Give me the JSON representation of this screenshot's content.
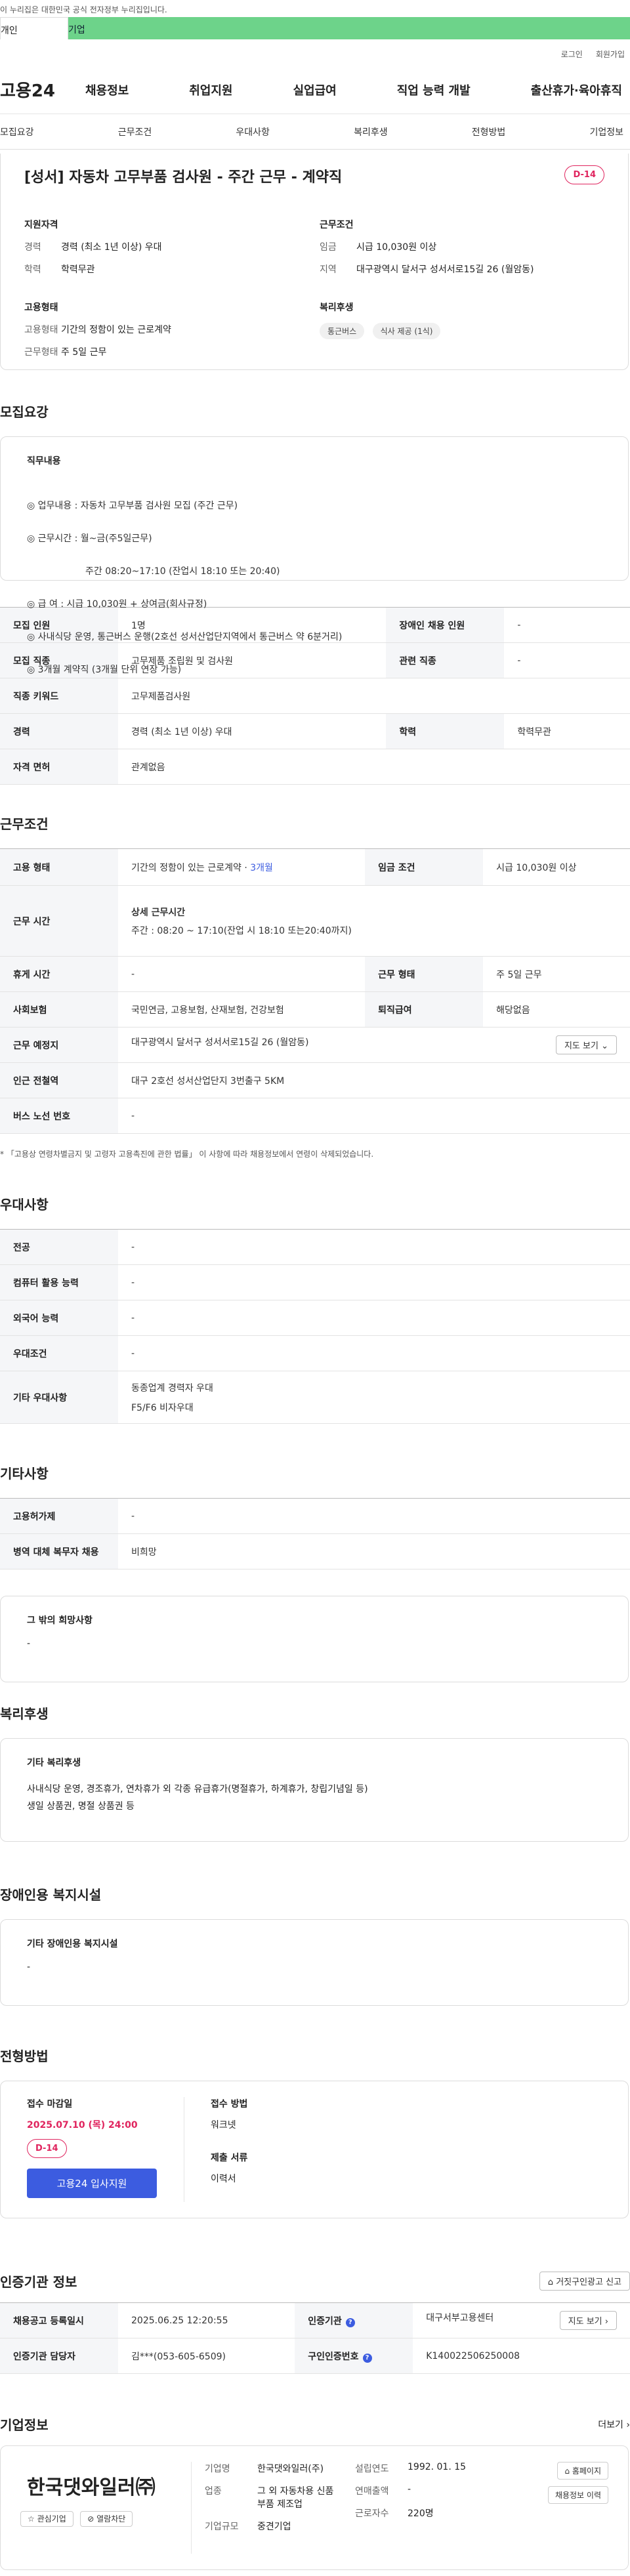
{
  "topbar": {
    "notice": "이 누리집은 대한민국 공식 전자정부 누리집입니다."
  },
  "site_tabs": [
    "개인",
    "기업"
  ],
  "util": [
    "로그인",
    "회원가입"
  ],
  "gnb": {
    "logo": "고용24",
    "menu": [
      "채용정보",
      "취업지원",
      "실업급여",
      "직업 능력 개발",
      "출산휴가·육아휴직"
    ]
  },
  "anchors": [
    "모집요강",
    "근무조건",
    "우대사항",
    "복리후생",
    "전형방법",
    "기업정보"
  ],
  "hero": {
    "title": "[성서] 자동차 고무부품 검사원 - 주간 근무 - 계약직",
    "dday": "D-14",
    "qual_title": "지원자격",
    "qual": [
      {
        "k": "경력",
        "v": "경력 (최소 1년 이상) 우대"
      },
      {
        "k": "학력",
        "v": "학력무관"
      }
    ],
    "emp_title": "고용형태",
    "emp": [
      {
        "k": "고용형태",
        "v": "기간의 정함이 있는 근로계약"
      },
      {
        "k": "근무형태",
        "v": "주 5일 근무"
      }
    ],
    "cond_title": "근무조건",
    "cond": [
      {
        "k": "임금",
        "v": "시급 10,030원 이상"
      },
      {
        "k": "지역",
        "v": "대구광역시 달서구 성서서로15길 26 (월암동)"
      }
    ],
    "welfare_title": "복리후생",
    "welfare_chips": [
      "통근버스",
      "식사 제공 (1식)"
    ]
  },
  "recruit": {
    "title": "모집요강",
    "box_title": "직무내용",
    "lines": [
      "◎ 업무내용 : 자동차 고무부품 검사원 모집 (주간 근무)",
      "◎ 근무시간 : 월~금(주5일근무)",
      "                    주간 08:20~17:10 (잔업시 18:10 또는 20:40)",
      "◎ 급 여 : 시급 10,030원 + 상여금(회사규정)",
      "◎ 사내식당 운영, 통근버스 운행(2호선 성서산업단지역에서 통근버스 약 6분거리)",
      "◎ 3개월 계약직 (3개월 단위 연장 가능)"
    ],
    "table": [
      [
        "모집 인원",
        "1명",
        "장애인 채용 인원",
        "-"
      ],
      [
        "모집 직종",
        "고무제품 조립원 및 검사원",
        "관련 직종",
        "-"
      ],
      [
        "직종 키워드",
        "고무제품검사원"
      ],
      [
        "경력",
        "경력 (최소 1년 이상) 우대",
        "학력",
        "학력무관"
      ],
      [
        "자격 면허",
        "관계없음"
      ]
    ]
  },
  "work": {
    "title": "근무조건",
    "emp_type_label": "고용 형태",
    "emp_type": "기간의 정함이 있는 근로계약 · ",
    "emp_type_months": "3개월",
    "wage_label": "임금 조건",
    "wage": "시급 10,030원 이상",
    "hours_label": "근무 시간",
    "hours_sub": "상세 근무시간",
    "hours": "주간 : 08:20 ~ 17:10(잔업 시 18:10 또는20:40까지)",
    "break_label": "휴게 시간",
    "break": "-",
    "shift_label": "근무 형태",
    "shift": "주 5일 근무",
    "ins_label": "사회보험",
    "ins": "국민연금, 고용보험, 산재보험, 건강보험",
    "retire_label": "퇴직급여",
    "retire": "해당없음",
    "place_label": "근무 예정지",
    "place": "대구광역시 달서구 성서서로15길 26 (월암동)",
    "map_btn": "지도 보기",
    "subway_label": "인근 전철역",
    "subway": "대구 2호선 성서산업단지 3번출구 5KM",
    "bus_label": "버스 노선 번호",
    "bus": "-",
    "note": "* 「고용상 연령차별금지 및 고령자 고용촉진에 관한 법률」 이 사항에 따라 채용정보에서 연령이 삭제되었습니다."
  },
  "pref": {
    "title": "우대사항",
    "rows": [
      [
        "전공",
        "-"
      ],
      [
        "컴퓨터 활용 능력",
        "-"
      ],
      [
        "외국어 능력",
        "-"
      ],
      [
        "우대조건",
        "-"
      ]
    ],
    "etc_label": "기타 우대사항",
    "etc_lines": [
      "동종업계 경력자 우대",
      "F5/F6 비자우대"
    ]
  },
  "other": {
    "title": "기타사항",
    "rows": [
      [
        "고용허가제",
        "-"
      ],
      [
        "병역 대체 복무자 채용",
        "비희망"
      ]
    ],
    "hope_title": "그 밖의 희망사항",
    "hope": "-"
  },
  "welfare": {
    "title": "복리후생",
    "box_title": "기타 복리후생",
    "lines": [
      "사내식당 운영, 경조휴가, 연차휴가 외 각종 유급휴가(명절휴가, 하계휴가, 창립기념일 등)",
      "생일 상품권, 명절 상품권 등"
    ]
  },
  "disabled": {
    "title": "장애인용 복지시설",
    "box_title": "기타 장애인용 복지시설",
    "value": "-"
  },
  "apply": {
    "title": "전형방법",
    "deadline_label": "접수 마감일",
    "deadline": "2025.07.10 (목) 24:00",
    "dday": "D-14",
    "apply_btn": "고용24 입사지원",
    "method_label": "접수 방법",
    "method": "워크넷",
    "docs_label": "제출 서류",
    "docs": "이력서"
  },
  "agency": {
    "title": "인증기관 정보",
    "report_btn": "거짓구인광고 신고",
    "rows": [
      [
        "채용공고 등록일시",
        "2025.06.25 12:20:55",
        "인증기관",
        "대구서부고용센터"
      ],
      [
        "인증기관 담당자",
        "김***(053-605-6509)",
        "구인인증번호",
        "K140022506250008"
      ]
    ],
    "map_btn": "지도 보기"
  },
  "company": {
    "title": "기업정보",
    "more": "더보기",
    "logo_text": "한국댓와일러㈜",
    "fav_btn": "관심기업",
    "block_btn": "열람차단",
    "fields": [
      [
        "기업명",
        "한국댓와일러(주)"
      ],
      [
        "업종",
        "그 외 자동차용 신품 부품 제조업"
      ],
      [
        "기업규모",
        "중견기업"
      ]
    ],
    "fields2": [
      [
        "설립연도",
        "1992. 01. 15"
      ],
      [
        "연매출액",
        "-"
      ],
      [
        "근로자수",
        "220명"
      ]
    ],
    "home_btn": "홈페이지",
    "history_btn": "채용정보 이력"
  }
}
